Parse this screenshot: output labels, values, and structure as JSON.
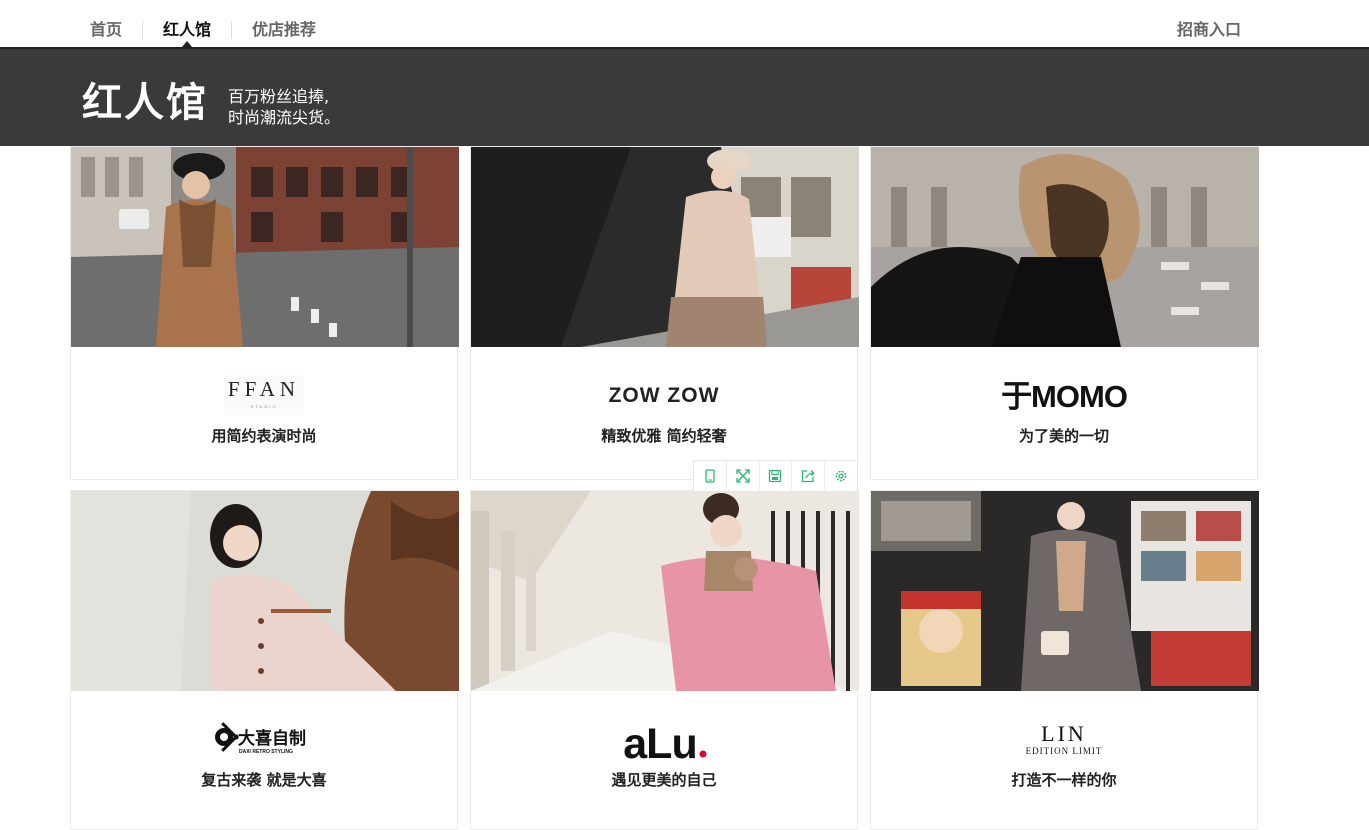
{
  "nav": {
    "tabs": [
      {
        "label": "首页"
      },
      {
        "label": "红人馆",
        "active": true
      },
      {
        "label": "优店推荐"
      }
    ],
    "merchant_link": "招商入口"
  },
  "banner": {
    "title": "红人馆",
    "slogan_line1": "百万粉丝追捧,",
    "slogan_line2": "时尚潮流尖货。"
  },
  "shops": [
    {
      "brand": "FFAN",
      "brand_sub": "STUDIO",
      "tagline": "用简约表演时尚"
    },
    {
      "brand": "ZOW ZOW",
      "tagline": "精致优雅 简约轻奢"
    },
    {
      "brand": "于MOMO",
      "tagline": "为了美的一切"
    },
    {
      "brand": "大喜自制",
      "brand_sub": "DAXI RETRO STYLING",
      "tagline": "复古来袭 就是大喜"
    },
    {
      "brand": "aLu",
      "tagline": "遇见更美的自己"
    },
    {
      "brand": "LIN",
      "brand_sub": "EDITION LIMIT",
      "tagline": "打造不一样的你"
    }
  ],
  "toolbar": {
    "icons": [
      "phone-icon",
      "fullscreen-icon",
      "save-icon",
      "share-icon",
      "settings-icon"
    ],
    "accent": "#2bb673"
  },
  "colors": {
    "banner_bg": "#3a3a3a",
    "nav_line": "#222222",
    "alu_dot": "#e4002b"
  }
}
